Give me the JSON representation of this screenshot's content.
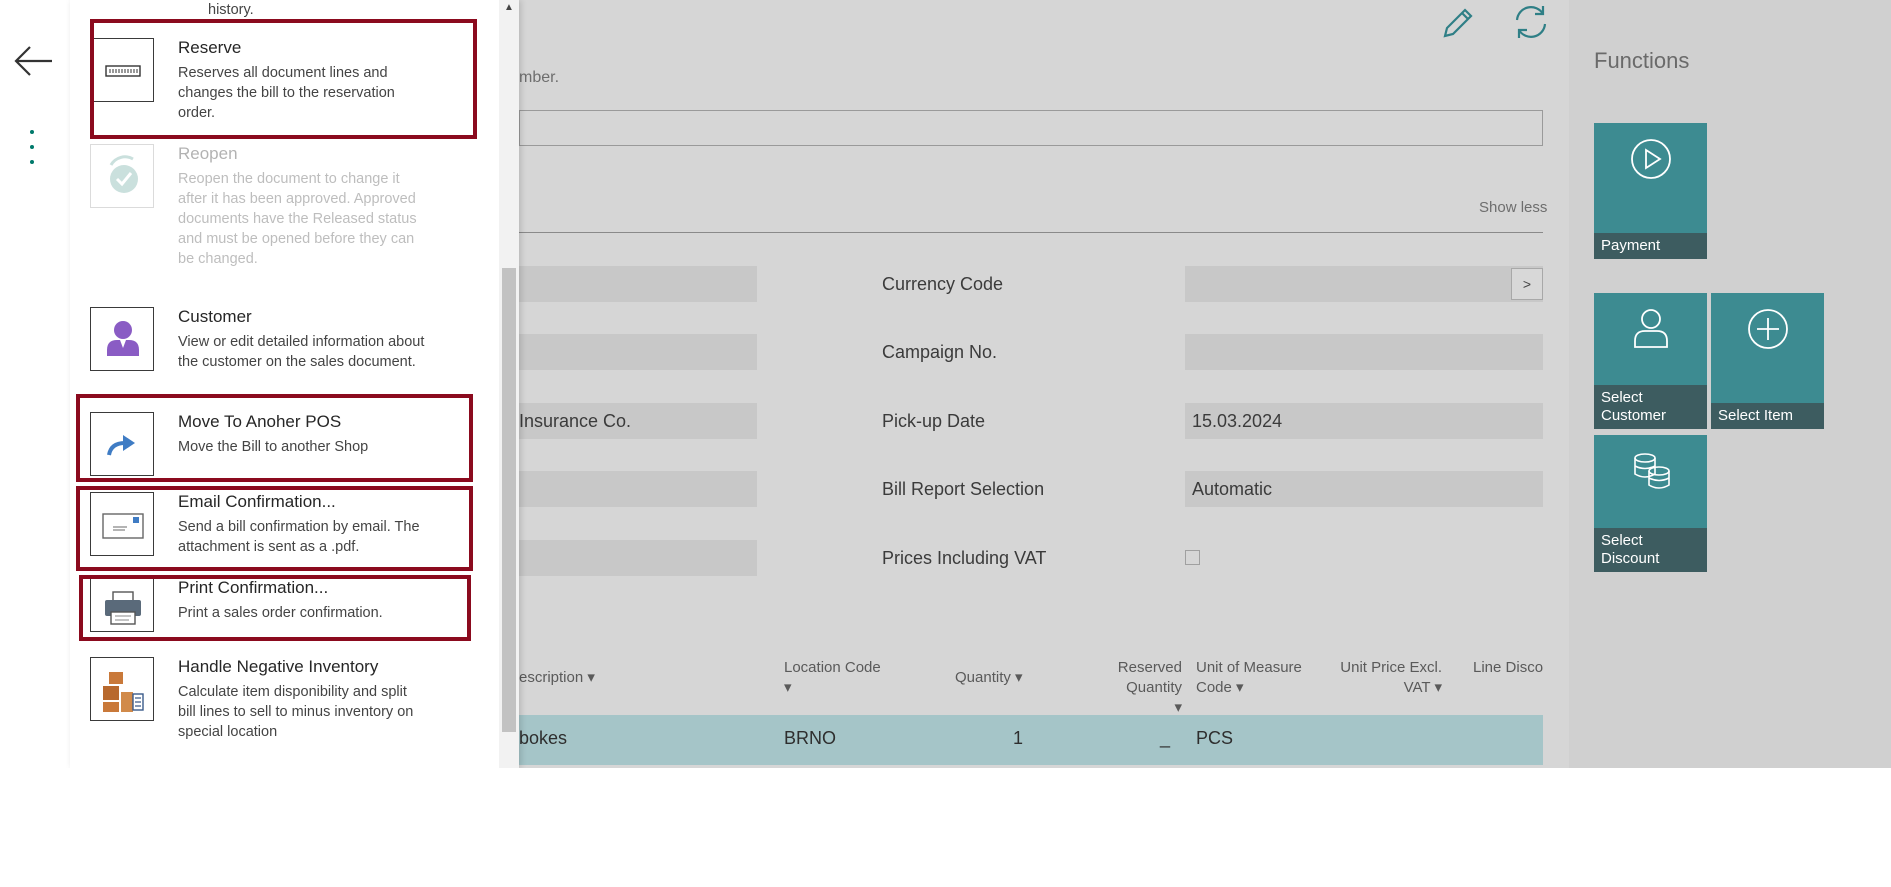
{
  "nav": {
    "back_icon": "back-arrow-icon",
    "more_icon": "vertical-ellipsis-icon"
  },
  "header_icons": [
    "pencil-icon",
    "refresh-icon"
  ],
  "background_page": {
    "hint_text": "mber.",
    "show_less": "Show less",
    "fields": [
      {
        "label": "Currency Code",
        "value": "",
        "has_lookup": true,
        "lookup_label": ">"
      },
      {
        "label": "Campaign No.",
        "value": ""
      },
      {
        "label": "Pick-up Date",
        "value": "15.03.2024"
      },
      {
        "label": "Bill Report Selection",
        "value": "Automatic"
      },
      {
        "label": "Prices Including VAT",
        "value": false
      }
    ],
    "left_field_fragment": "Insurance Co.",
    "lines": {
      "columns": [
        {
          "label": "escription",
          "sort": "▾"
        },
        {
          "label": "Location Code",
          "sort": "▾"
        },
        {
          "label": "Quantity",
          "sort": "▾"
        },
        {
          "label": "Reserved Quantity",
          "sort": "▾"
        },
        {
          "label": "Unit of Measure Code",
          "sort": "▾"
        },
        {
          "label": "Unit Price Excl. VAT",
          "sort": "▾"
        },
        {
          "label": "Line Discou",
          "sort": ""
        }
      ],
      "rows": [
        {
          "description": "bokes",
          "location": "BRNO",
          "quantity": "1",
          "reserved": "_",
          "uom": "PCS"
        }
      ]
    }
  },
  "functions": {
    "title": "Functions",
    "tiles": [
      {
        "label": "Payment",
        "icon": "play-circle-icon"
      },
      {
        "label": "Select Customer",
        "icon": "person-icon"
      },
      {
        "label": "Select Item",
        "icon": "plus-circle-icon"
      },
      {
        "label": "Select Discount",
        "icon": "coins-icon"
      }
    ]
  },
  "flyout": {
    "top_fragment": "history.",
    "actions": [
      {
        "title": "Reserve",
        "description": "Reserves all document lines and changes the bill to the reservation order.",
        "icon": "reserve-icon",
        "enabled": true,
        "highlighted": true
      },
      {
        "title": "Reopen",
        "description": "Reopen the document to change it after it has been approved. Approved documents have the Released status and must be opened before they can be changed.",
        "icon": "reopen-icon",
        "enabled": false,
        "highlighted": false
      },
      {
        "title": "Customer",
        "description": "View or edit detailed information about the customer on the sales document.",
        "icon": "customer-icon",
        "enabled": true,
        "highlighted": false
      },
      {
        "title": "Move To Anoher POS",
        "description": "Move the Bill to another Shop",
        "icon": "move-arrow-icon",
        "enabled": true,
        "highlighted": true
      },
      {
        "title": "Email Confirmation...",
        "description": "Send a bill confirmation by email. The attachment is sent as a .pdf.",
        "icon": "email-icon",
        "enabled": true,
        "highlighted": true
      },
      {
        "title": "Print Confirmation...",
        "description": "Print a sales order confirmation.",
        "icon": "printer-icon",
        "enabled": true,
        "highlighted": true
      },
      {
        "title": "Handle Negative Inventory",
        "description": "Calculate item disponibility and split bill lines to sell to minus inventory on special location",
        "icon": "inventory-icon",
        "enabled": true,
        "highlighted": false
      }
    ]
  },
  "colors": {
    "accent": "#00796b",
    "tile": "#3d8b91",
    "tile_label": "#3d5c60",
    "highlight": "#8b0a1e",
    "row_selected": "#a5c5c8"
  }
}
